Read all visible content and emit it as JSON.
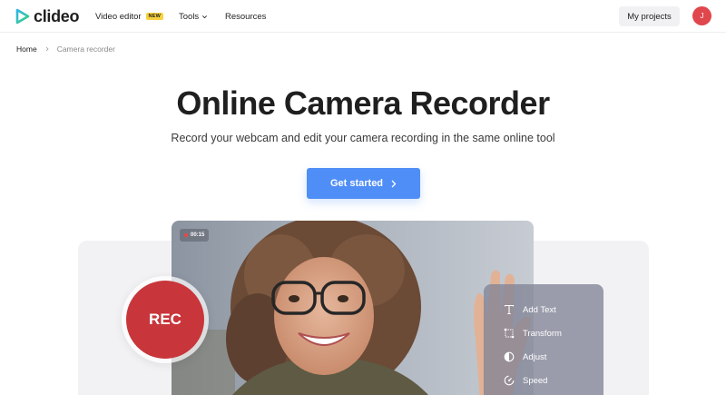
{
  "header": {
    "logo_text": "clideo",
    "nav": {
      "video_editor": "Video editor",
      "new_badge": "NEW",
      "tools": "Tools",
      "resources": "Resources"
    },
    "my_projects": "My projects",
    "avatar_initial": "J"
  },
  "breadcrumb": {
    "home": "Home",
    "current": "Camera recorder"
  },
  "hero": {
    "title": "Online Camera Recorder",
    "subtitle": "Record your webcam and edit your camera recording in the same online tool",
    "cta": "Get started"
  },
  "preview": {
    "timer": "00:15",
    "rec_label": "REC",
    "menu": [
      {
        "label": "Add Text",
        "icon": "text-icon"
      },
      {
        "label": "Transform",
        "icon": "transform-icon"
      },
      {
        "label": "Adjust",
        "icon": "adjust-icon"
      },
      {
        "label": "Speed",
        "icon": "speed-icon"
      }
    ]
  },
  "colors": {
    "accent": "#4f8ef7",
    "rec": "#c8353a",
    "avatar": "#e0474c",
    "badge": "#f7d23e"
  }
}
